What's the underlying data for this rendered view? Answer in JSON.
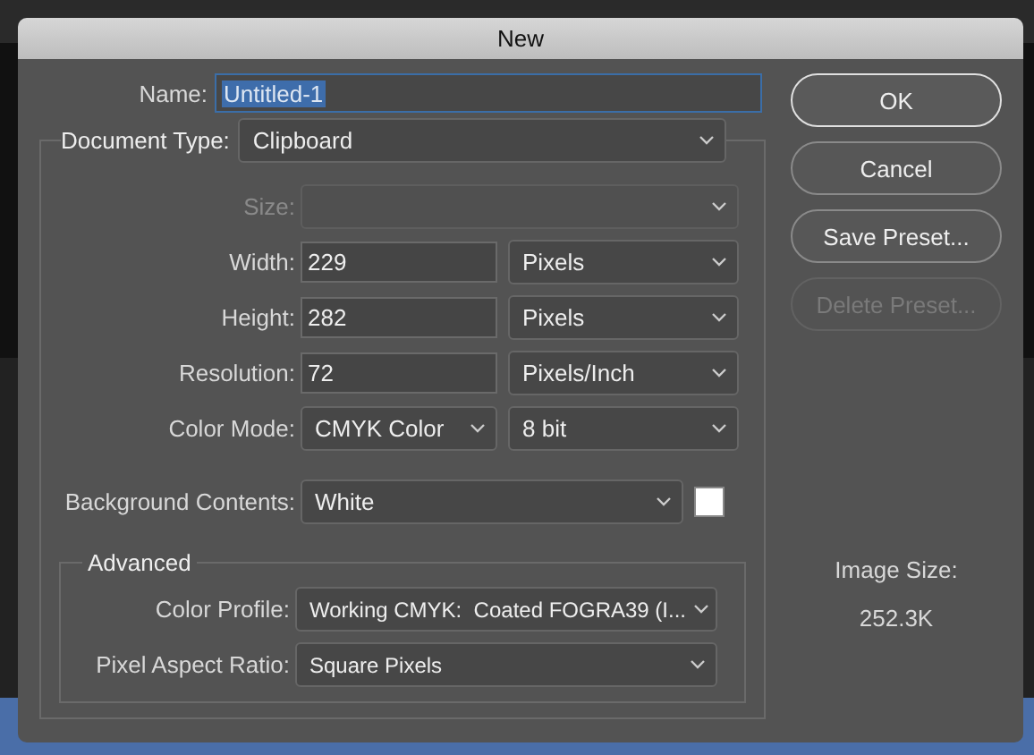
{
  "window": {
    "title": "New"
  },
  "name": {
    "label": "Name:",
    "value": "Untitled-1"
  },
  "document_type": {
    "label": "Document Type:",
    "value": "Clipboard"
  },
  "rows": [
    {
      "label": "Size:",
      "disabled": true,
      "controls": [
        {
          "kind": "select",
          "disabled": true
        }
      ]
    },
    {
      "label": "Width:",
      "disabled": false,
      "controls": [
        {
          "kind": "input",
          "value": "229"
        },
        {
          "kind": "select",
          "value": "Pixels"
        }
      ]
    },
    {
      "label": "Height:",
      "disabled": false,
      "controls": [
        {
          "kind": "input",
          "value": "282"
        },
        {
          "kind": "select",
          "value": "Pixels"
        }
      ]
    },
    {
      "label": "Resolution:",
      "disabled": false,
      "controls": [
        {
          "kind": "input",
          "value": "72"
        },
        {
          "kind": "select",
          "value": "Pixels/Inch"
        }
      ]
    },
    {
      "label": "Color Mode:",
      "disabled": false,
      "controls": [
        {
          "kind": "select",
          "value": "CMYK Color"
        },
        {
          "kind": "select",
          "value": "8 bit"
        }
      ]
    },
    {
      "label": "Background Contents:",
      "disabled": false,
      "controls": [
        {
          "kind": "select",
          "value": "White"
        },
        {
          "kind": "swatch",
          "color": "#ffffff"
        }
      ]
    }
  ],
  "advanced": {
    "title": "Advanced",
    "rows": [
      {
        "label": "Color Profile:",
        "value": "Working CMYK:  Coated FOGRA39 (I..."
      },
      {
        "label": "Pixel Aspect Ratio:",
        "value": "Square Pixels"
      }
    ]
  },
  "buttons": [
    {
      "label": "OK",
      "default": true,
      "disabled": false
    },
    {
      "label": "Cancel",
      "default": false,
      "disabled": false
    },
    {
      "label": "Save Preset...",
      "default": false,
      "disabled": false
    },
    {
      "label": "Delete Preset...",
      "default": false,
      "disabled": true
    }
  ],
  "image_size": {
    "label": "Image Size:",
    "value": "252.3K"
  }
}
